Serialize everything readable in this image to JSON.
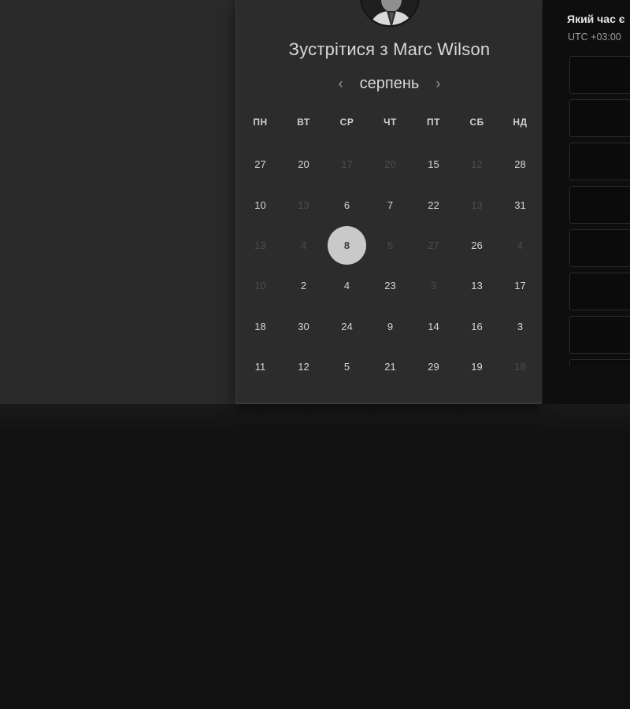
{
  "meeting": {
    "title": "Зустрітися з Marc Wilson"
  },
  "calendar": {
    "month": "серпень",
    "prev_icon": "chevron-left-icon",
    "next_icon": "chevron-right-icon",
    "prev_glyph": "‹",
    "next_glyph": "›",
    "weekdays": [
      "ПН",
      "ВТ",
      "СР",
      "ЧТ",
      "ПТ",
      "СБ",
      "НД"
    ],
    "weeks": [
      [
        {
          "d": "27",
          "a": true
        },
        {
          "d": "20",
          "a": true
        },
        {
          "d": "17",
          "a": false
        },
        {
          "d": "20",
          "a": false
        },
        {
          "d": "15",
          "a": true
        },
        {
          "d": "12",
          "a": false
        },
        {
          "d": "28",
          "a": true
        }
      ],
      [
        {
          "d": "10",
          "a": true
        },
        {
          "d": "13",
          "a": false
        },
        {
          "d": "6",
          "a": true
        },
        {
          "d": "7",
          "a": true
        },
        {
          "d": "22",
          "a": true
        },
        {
          "d": "13",
          "a": false
        },
        {
          "d": "31",
          "a": true
        }
      ],
      [
        {
          "d": "13",
          "a": false
        },
        {
          "d": "4",
          "a": false
        },
        {
          "d": "8",
          "a": true,
          "sel": true
        },
        {
          "d": "5",
          "a": false
        },
        {
          "d": "27",
          "a": false
        },
        {
          "d": "26",
          "a": true
        },
        {
          "d": "4",
          "a": false
        }
      ],
      [
        {
          "d": "10",
          "a": false
        },
        {
          "d": "2",
          "a": true
        },
        {
          "d": "4",
          "a": true
        },
        {
          "d": "23",
          "a": true
        },
        {
          "d": "3",
          "a": false
        },
        {
          "d": "13",
          "a": true
        },
        {
          "d": "17",
          "a": true
        }
      ],
      [
        {
          "d": "18",
          "a": true
        },
        {
          "d": "30",
          "a": true
        },
        {
          "d": "24",
          "a": true
        },
        {
          "d": "9",
          "a": true
        },
        {
          "d": "14",
          "a": true
        },
        {
          "d": "16",
          "a": true
        },
        {
          "d": "3",
          "a": true
        }
      ],
      [
        {
          "d": "11",
          "a": true
        },
        {
          "d": "12",
          "a": true
        },
        {
          "d": "5",
          "a": true
        },
        {
          "d": "21",
          "a": true
        },
        {
          "d": "29",
          "a": true
        },
        {
          "d": "19",
          "a": true
        },
        {
          "d": "18",
          "a": false
        }
      ]
    ]
  },
  "time_panel": {
    "question": "Який час є",
    "timezone": "UTC +03:00",
    "slot_count": 8
  },
  "colors": {
    "page_bg": "#111111",
    "panel_bg": "#2c2c2c",
    "selected_day_bg": "#c9c9c9",
    "muted_day": "#4c4c4c"
  },
  "icons": {
    "avatar": "profile-photo"
  }
}
